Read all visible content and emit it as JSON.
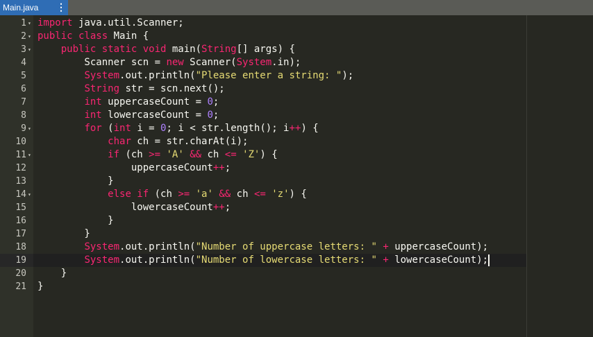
{
  "tab": {
    "title": "Main.java",
    "menu_icon": "more-vertical-icon"
  },
  "editor": {
    "active_line": 19,
    "lines": [
      {
        "n": "1",
        "fold": true,
        "tokens": [
          [
            "kw",
            "import"
          ],
          [
            "p",
            " java.util.Scanner;"
          ]
        ]
      },
      {
        "n": "2",
        "fold": true,
        "tokens": [
          [
            "kw",
            "public class"
          ],
          [
            "p",
            " Main {"
          ]
        ]
      },
      {
        "n": "3",
        "fold": true,
        "tokens": [
          [
            "p",
            "    "
          ],
          [
            "kw",
            "public static void"
          ],
          [
            "p",
            " main("
          ],
          [
            "kw",
            "String"
          ],
          [
            "p",
            "[] args) {"
          ]
        ]
      },
      {
        "n": "4",
        "fold": false,
        "tokens": [
          [
            "p",
            "        Scanner scn = "
          ],
          [
            "kw",
            "new"
          ],
          [
            "p",
            " Scanner("
          ],
          [
            "kw",
            "System"
          ],
          [
            "p",
            ".in);"
          ]
        ]
      },
      {
        "n": "5",
        "fold": false,
        "tokens": [
          [
            "p",
            "        "
          ],
          [
            "kw",
            "System"
          ],
          [
            "p",
            ".out.println("
          ],
          [
            "st",
            "\"Please enter a string: \""
          ],
          [
            "p",
            ");"
          ]
        ]
      },
      {
        "n": "6",
        "fold": false,
        "tokens": [
          [
            "p",
            "        "
          ],
          [
            "kw",
            "String"
          ],
          [
            "p",
            " str = scn.next();"
          ]
        ]
      },
      {
        "n": "7",
        "fold": false,
        "tokens": [
          [
            "p",
            "        "
          ],
          [
            "kw",
            "int"
          ],
          [
            "p",
            " uppercaseCount = "
          ],
          [
            "nm",
            "0"
          ],
          [
            "p",
            ";"
          ]
        ]
      },
      {
        "n": "8",
        "fold": false,
        "tokens": [
          [
            "p",
            "        "
          ],
          [
            "kw",
            "int"
          ],
          [
            "p",
            " lowercaseCount = "
          ],
          [
            "nm",
            "0"
          ],
          [
            "p",
            ";"
          ]
        ]
      },
      {
        "n": "9",
        "fold": true,
        "tokens": [
          [
            "p",
            "        "
          ],
          [
            "kw",
            "for"
          ],
          [
            "p",
            " ("
          ],
          [
            "kw",
            "int"
          ],
          [
            "p",
            " i = "
          ],
          [
            "nm",
            "0"
          ],
          [
            "p",
            "; i < str.length(); i"
          ],
          [
            "kw",
            "++"
          ],
          [
            "p",
            ") {"
          ]
        ]
      },
      {
        "n": "10",
        "fold": false,
        "tokens": [
          [
            "p",
            "            "
          ],
          [
            "kw",
            "char"
          ],
          [
            "p",
            " ch = str.charAt(i);"
          ]
        ]
      },
      {
        "n": "11",
        "fold": true,
        "tokens": [
          [
            "p",
            "            "
          ],
          [
            "kw",
            "if"
          ],
          [
            "p",
            " (ch "
          ],
          [
            "kw",
            ">="
          ],
          [
            "p",
            " "
          ],
          [
            "st",
            "'A'"
          ],
          [
            "p",
            " "
          ],
          [
            "kw",
            "&&"
          ],
          [
            "p",
            " ch "
          ],
          [
            "kw",
            "<="
          ],
          [
            "p",
            " "
          ],
          [
            "st",
            "'Z'"
          ],
          [
            "p",
            ") {"
          ]
        ]
      },
      {
        "n": "12",
        "fold": false,
        "tokens": [
          [
            "p",
            "                uppercaseCount"
          ],
          [
            "kw",
            "++"
          ],
          [
            "p",
            ";"
          ]
        ]
      },
      {
        "n": "13",
        "fold": false,
        "tokens": [
          [
            "p",
            "            }"
          ]
        ]
      },
      {
        "n": "14",
        "fold": true,
        "tokens": [
          [
            "p",
            "            "
          ],
          [
            "kw",
            "else if"
          ],
          [
            "p",
            " (ch "
          ],
          [
            "kw",
            ">="
          ],
          [
            "p",
            " "
          ],
          [
            "st",
            "'a'"
          ],
          [
            "p",
            " "
          ],
          [
            "kw",
            "&&"
          ],
          [
            "p",
            " ch "
          ],
          [
            "kw",
            "<="
          ],
          [
            "p",
            " "
          ],
          [
            "st",
            "'z'"
          ],
          [
            "p",
            ") {"
          ]
        ]
      },
      {
        "n": "15",
        "fold": false,
        "tokens": [
          [
            "p",
            "                lowercaseCount"
          ],
          [
            "kw",
            "++"
          ],
          [
            "p",
            ";"
          ]
        ]
      },
      {
        "n": "16",
        "fold": false,
        "tokens": [
          [
            "p",
            "            }"
          ]
        ]
      },
      {
        "n": "17",
        "fold": false,
        "tokens": [
          [
            "p",
            "        }"
          ]
        ]
      },
      {
        "n": "18",
        "fold": false,
        "tokens": [
          [
            "p",
            "        "
          ],
          [
            "kw",
            "System"
          ],
          [
            "p",
            ".out.println("
          ],
          [
            "st",
            "\"Number of uppercase letters: \""
          ],
          [
            "p",
            " "
          ],
          [
            "kw",
            "+"
          ],
          [
            "p",
            " uppercaseCount);"
          ]
        ]
      },
      {
        "n": "19",
        "fold": false,
        "tokens": [
          [
            "p",
            "        "
          ],
          [
            "kw",
            "System"
          ],
          [
            "p",
            ".out.println("
          ],
          [
            "st",
            "\"Number of lowercase letters: \""
          ],
          [
            "p",
            " "
          ],
          [
            "kw",
            "+"
          ],
          [
            "p",
            " lowercaseCount);"
          ]
        ]
      },
      {
        "n": "20",
        "fold": false,
        "tokens": [
          [
            "p",
            "    }"
          ]
        ]
      },
      {
        "n": "21",
        "fold": false,
        "tokens": [
          [
            "p",
            "}"
          ]
        ]
      }
    ]
  }
}
